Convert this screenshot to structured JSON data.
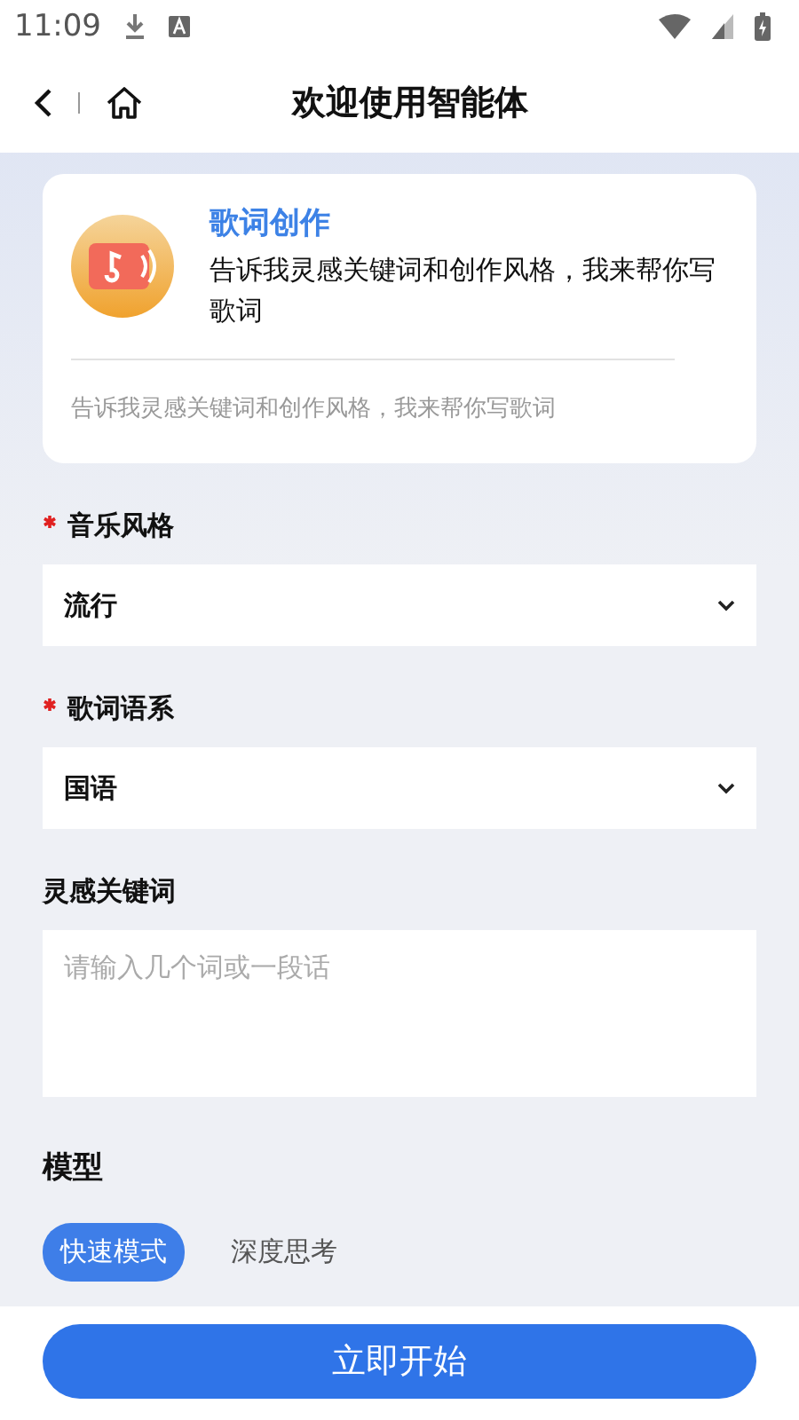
{
  "status_bar": {
    "time": "11:09"
  },
  "header": {
    "title": "欢迎使用智能体"
  },
  "agent": {
    "name": "歌词创作",
    "description": "告诉我灵感关键词和创作风格，我来帮你写歌词",
    "hint": "告诉我灵感关键词和创作风格，我来帮你写歌词"
  },
  "fields": [
    {
      "kind": "select",
      "label": "音乐风格",
      "required": true,
      "value": "流行"
    },
    {
      "kind": "select",
      "label": "歌词语系",
      "required": true,
      "value": "国语"
    },
    {
      "kind": "textarea",
      "label": "灵感关键词",
      "required": false,
      "placeholder": "请输入几个词或一段话"
    }
  ],
  "model": {
    "label": "模型",
    "options": [
      {
        "label": "快速模式",
        "selected": true
      },
      {
        "label": "深度思考",
        "selected": false
      }
    ]
  },
  "start_button": "立即开始"
}
